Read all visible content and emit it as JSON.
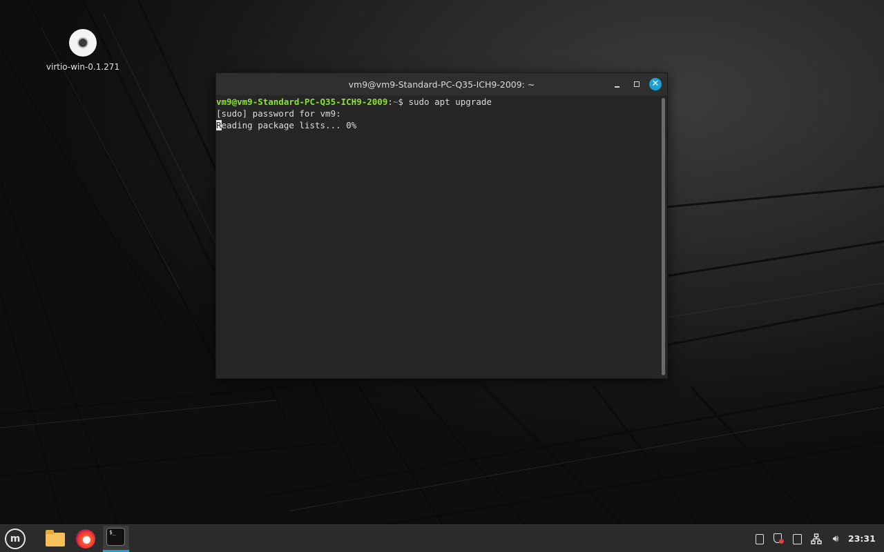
{
  "desktop": {
    "icons": [
      {
        "label": "virtio-win-0.1.271",
        "icon": "cd-disc-icon"
      }
    ]
  },
  "terminal": {
    "title": "vm9@vm9-Standard-PC-Q35-ICH9-2009: ~",
    "lines": {
      "prompt_user": "vm9@vm9-Standard-PC-Q35-ICH9-2009",
      "prompt_sep": ":",
      "prompt_path": "~",
      "prompt_symbol": "$ ",
      "command": "sudo apt upgrade",
      "sudo_prompt": "[sudo] password for vm9:",
      "progress_cursor_char": "R",
      "progress_rest": "eading package lists... 0%"
    }
  },
  "taskbar": {
    "apps": [
      {
        "name": "menu",
        "icon": "linux-mint-logo-icon"
      },
      {
        "name": "files",
        "icon": "folder-icon"
      },
      {
        "name": "firefox",
        "icon": "firefox-icon"
      },
      {
        "name": "terminal",
        "icon": "terminal-icon",
        "active": true,
        "glyph": "$_"
      }
    ],
    "tray": {
      "icons": [
        "clipboard-icon",
        "shield-update-icon",
        "notes-icon",
        "network-icon",
        "volume-icon"
      ],
      "clock": "23:31"
    }
  },
  "colors": {
    "accent": "#27a0d6",
    "prompt_user": "#8ae234",
    "prompt_path": "#729fcf",
    "close_button": "#1e9fd6"
  }
}
